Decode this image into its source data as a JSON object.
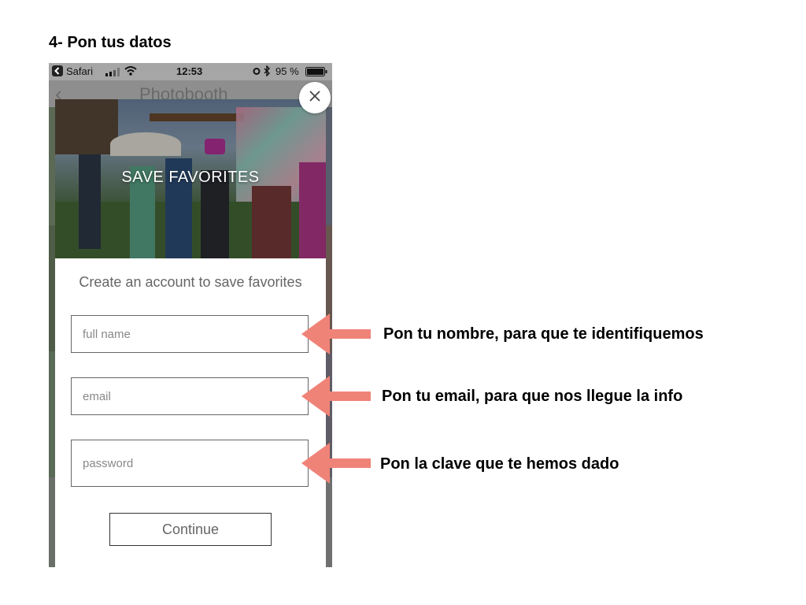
{
  "heading": "4- Pon tus datos",
  "status_bar": {
    "back_app": "Safari",
    "time": "12:53",
    "battery": "95 %"
  },
  "nav": {
    "title": "Photobooth"
  },
  "modal": {
    "hero_title": "SAVE FAVORITES",
    "subtitle": "Create an account to save favorites",
    "fields": {
      "full_name_placeholder": "full name",
      "email_placeholder": "email",
      "password_placeholder": "password"
    },
    "continue_label": "Continue"
  },
  "annotations": {
    "name": "Pon tu nombre, para que te identifiquemos",
    "email": "Pon tu email, para que nos llegue la info",
    "password": "Pon la clave que te hemos dado"
  },
  "colors": {
    "arrow": "#f08378",
    "field_border": "#666666"
  }
}
